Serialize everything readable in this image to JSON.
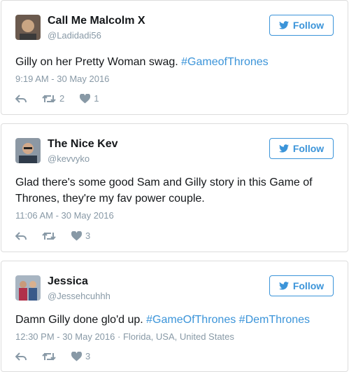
{
  "colors": {
    "accent": "#3b94d9",
    "text": "#14171a",
    "muted": "#8899a6",
    "border": "#dddddd"
  },
  "tweets": [
    {
      "name": "Call Me Malcolm X",
      "handle": "@Ladidadi56",
      "follow_label": "Follow",
      "text_plain": "Gilly on her Pretty Woman swag. ",
      "hashtag1": "#GameofThrones",
      "timestamp": "9:19 AM - 30 May 2016",
      "retweets": "2",
      "likes": "1",
      "icons": [
        "reply-icon",
        "retweet-icon",
        "like-heart-icon"
      ]
    },
    {
      "name": "The Nice Kev",
      "handle": "@kevvyko",
      "follow_label": "Follow",
      "text_plain": "Glad there's some good Sam and Gilly story in this Game of Thrones, they're my fav power couple.",
      "timestamp": "11:06 AM - 30 May 2016",
      "likes": "3",
      "icons": [
        "reply-icon",
        "retweet-icon",
        "like-heart-icon"
      ]
    },
    {
      "name": "Jessica",
      "handle": "@Jessehcuhhh",
      "follow_label": "Follow",
      "text_plain": "Damn Gilly done glo'd up. ",
      "hashtag1": "#GameOfThrones",
      "hashtag2": "#DemThrones",
      "timestamp": "12:30 PM - 30 May 2016",
      "location": "Florida, USA, United States",
      "likes": "3",
      "icons": [
        "reply-icon",
        "retweet-icon",
        "like-heart-icon"
      ]
    }
  ]
}
